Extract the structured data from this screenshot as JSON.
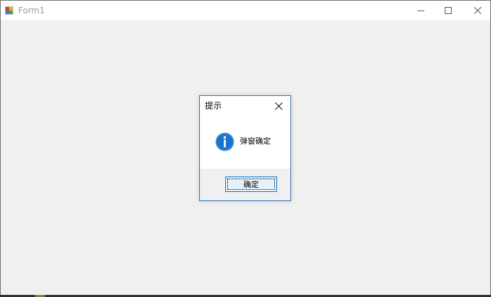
{
  "window": {
    "title": "Form1"
  },
  "dialog": {
    "title": "提示",
    "message": "弹窗确定",
    "ok_label": "确定"
  },
  "icons": {
    "app": "app-icon",
    "minimize": "minimize-icon",
    "maximize": "maximize-icon",
    "close": "close-icon",
    "info": "info-icon"
  },
  "colors": {
    "accent": "#0078d7",
    "dialog_border": "#2b73b9",
    "info_icon": "#1a74c8",
    "window_bg": "#f0f0f0"
  }
}
